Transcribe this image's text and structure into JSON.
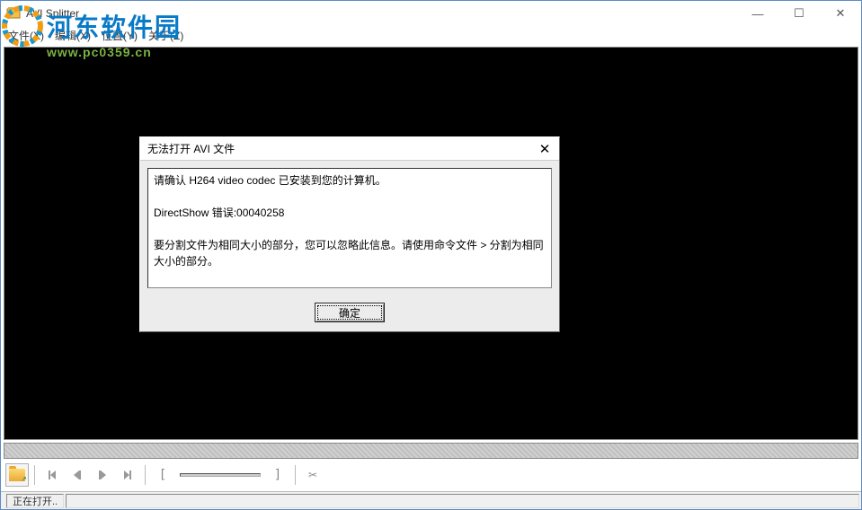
{
  "window": {
    "title": "AVI Splitter",
    "minimize_label": "—",
    "maximize_label": "☐",
    "close_label": "✕"
  },
  "menu": {
    "file": "文件(X)",
    "edit": "编辑(X)",
    "position": "位置(Y)",
    "about": "关于(Z)"
  },
  "watermark": {
    "text": "河东软件园",
    "url": "www.pc0359.cn"
  },
  "dialog": {
    "title": "无法打开 AVI 文件",
    "close": "✕",
    "line1": "请确认 H264 video codec 已安装到您的计算机。",
    "line2": "DirectShow 错误:00040258",
    "line3": "要分割文件为相同大小的部分，您可以忽略此信息。请使用命令文件 > 分割为相同大小的部分。",
    "ok": "确定"
  },
  "status": {
    "text": "正在打开.."
  },
  "toolbar": {
    "open": "open-file",
    "prev_frame": "prev-frame",
    "prev": "step-back",
    "next": "step-forward",
    "next_frame": "next-frame",
    "mark_in": "[",
    "mark_out": "]",
    "cut": "cut"
  }
}
